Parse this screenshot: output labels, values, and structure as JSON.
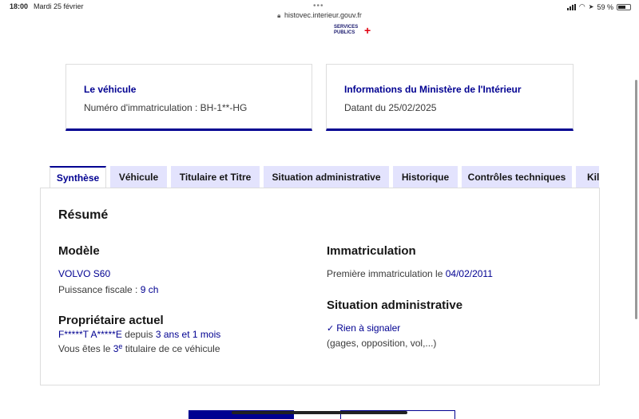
{
  "status_bar": {
    "time": "18:00",
    "date": "Mardi 25 février",
    "url": "histovec.interieur.gouv.fr",
    "battery": "59 %"
  },
  "logo": {
    "line1": "SERVICES",
    "line2": "PUBLICS",
    "plus": "+"
  },
  "cards": [
    {
      "title": "Le véhicule",
      "text": "Numéro d'immatriculation : BH-1**-HG"
    },
    {
      "title": "Informations du Ministère de l'Intérieur",
      "text": "Datant du 25/02/2025"
    }
  ],
  "tabs": [
    {
      "label": "Synthèse",
      "active": true
    },
    {
      "label": "Véhicule",
      "active": false
    },
    {
      "label": "Titulaire et Titre",
      "active": false
    },
    {
      "label": "Situation administrative",
      "active": false
    },
    {
      "label": "Historique",
      "active": false
    },
    {
      "label": "Contrôles techniques",
      "active": false
    },
    {
      "label": "Kil",
      "active": false
    }
  ],
  "summary": {
    "title": "Résumé",
    "modele": {
      "heading": "Modèle",
      "name": "VOLVO S60",
      "puissance_label": "Puissance fiscale : ",
      "puissance_value": "9 ch"
    },
    "immatriculation": {
      "heading": "Immatriculation",
      "label": "Première immatriculation le ",
      "date": "04/02/2011"
    },
    "situation": {
      "heading": "Situation administrative",
      "status": "Rien à signaler",
      "detail": "(gages, opposition, vol,...)"
    },
    "proprietaire": {
      "heading": "Propriétaire actuel",
      "name": "F*****T A*****E",
      "depuis": " depuis ",
      "duration": "3 ans et 1 mois",
      "rank_prefix": "Vous êtes le ",
      "rank_number": "3",
      "rank_sup": "e",
      "rank_suffix": " titulaire de ce véhicule"
    }
  },
  "colors": {
    "primary": "#000091",
    "tab_bg": "#e3e3fd",
    "border": "#dddddd",
    "accent_red": "#e1000f"
  }
}
